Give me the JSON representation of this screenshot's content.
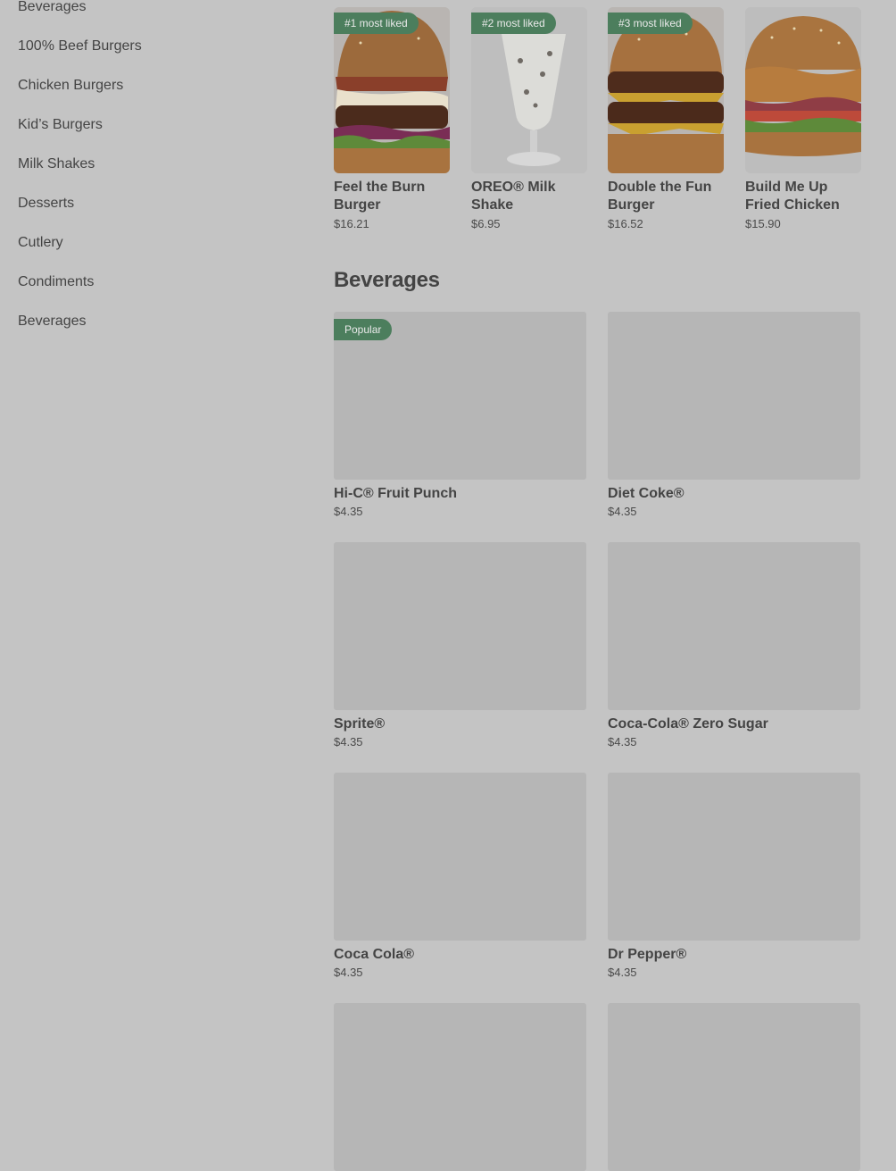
{
  "sidebar": {
    "items": [
      {
        "label": "Beverages"
      },
      {
        "label": "100% Beef Burgers"
      },
      {
        "label": "Chicken Burgers"
      },
      {
        "label": "Kid’s Burgers"
      },
      {
        "label": "Milk Shakes"
      },
      {
        "label": "Desserts"
      },
      {
        "label": "Cutlery"
      },
      {
        "label": "Condiments"
      },
      {
        "label": "Beverages"
      }
    ]
  },
  "top_items": [
    {
      "badge": "#1 most liked",
      "name": "Feel the Burn Burger",
      "price": "$16.21"
    },
    {
      "badge": "#2 most liked",
      "name": "OREO® Milk Shake",
      "price": "$6.95"
    },
    {
      "badge": "#3 most liked",
      "name": "Double the Fun Burger",
      "price": "$16.52"
    },
    {
      "name": "Build Me Up Fried Chicken",
      "price": "$15.90"
    }
  ],
  "beverages": {
    "title": "Beverages",
    "items": [
      {
        "badge": "Popular",
        "name": "Hi-C® Fruit Punch",
        "price": "$4.35"
      },
      {
        "name": "Diet Coke®",
        "price": "$4.35"
      },
      {
        "name": "Sprite®",
        "price": "$4.35"
      },
      {
        "name": "Coca-Cola® Zero Sugar",
        "price": "$4.35"
      },
      {
        "name": "Coca Cola®",
        "price": "$4.35"
      },
      {
        "name": "Dr Pepper®",
        "price": "$4.35"
      },
      {
        "name": "",
        "price": ""
      },
      {
        "name": "",
        "price": ""
      }
    ]
  },
  "colors": {
    "overlay_background": "#c4c4c4",
    "badge": "#4c7e5d",
    "placeholder_image": "#b6b6b6"
  }
}
